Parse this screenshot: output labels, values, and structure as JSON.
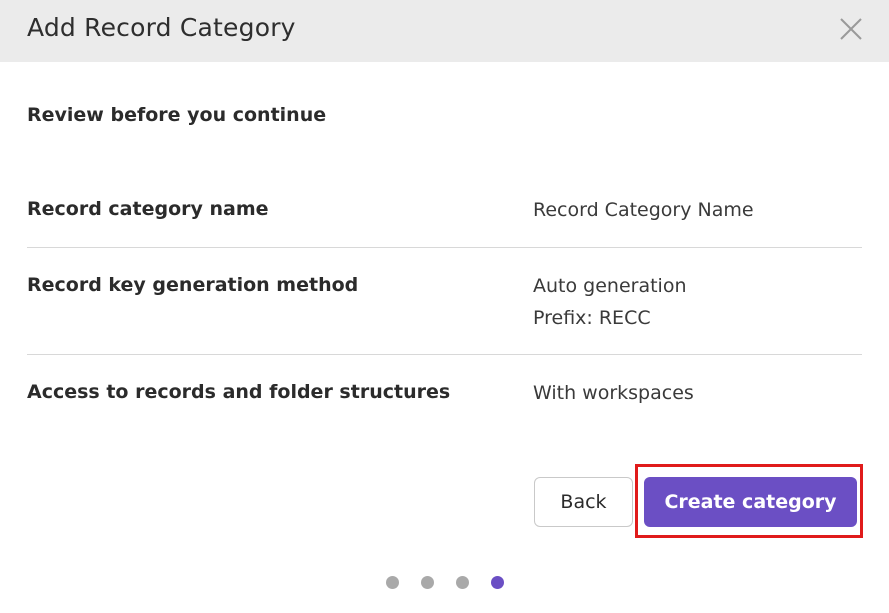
{
  "dialog": {
    "title": "Add Record Category",
    "close_icon": "close-icon"
  },
  "review": {
    "heading": "Review before you continue",
    "rows": [
      {
        "label": "Record category name",
        "values": [
          "Record Category Name"
        ]
      },
      {
        "label": "Record key generation method",
        "values": [
          "Auto generation",
          "Prefix: RECC"
        ]
      },
      {
        "label": "Access to records and folder structures",
        "values": [
          "With workspaces"
        ]
      }
    ]
  },
  "actions": {
    "back_label": "Back",
    "create_label": "Create category"
  },
  "stepper": {
    "total_steps": 4,
    "current_step": 4
  },
  "colors": {
    "header_bg": "#ebebeb",
    "primary": "#6b4fc4",
    "highlight": "#e01b1b",
    "dot_inactive": "#a9a9a9"
  }
}
